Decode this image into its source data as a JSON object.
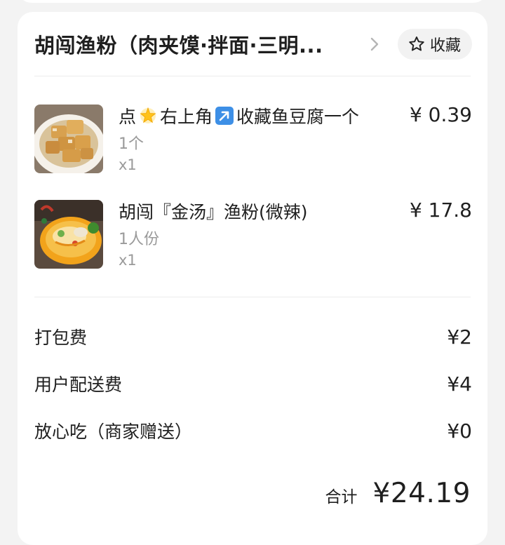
{
  "store": {
    "name": "胡闯渔粉（肉夹馍·拌面·三明...",
    "favorite_label": "收藏"
  },
  "items": [
    {
      "name_prefix": "点",
      "name_middle": "右上角",
      "name_suffix": "收藏鱼豆腐一个",
      "spec": "1个",
      "qty": "x1",
      "price": "¥ 0.39",
      "image_icon": "fish-tofu-image"
    },
    {
      "name": "胡闯『金汤』渔粉(微辣)",
      "spec": "1人份",
      "qty": "x1",
      "price": "¥ 17.8",
      "image_icon": "golden-soup-noodle-image"
    }
  ],
  "fees": [
    {
      "label": "打包费",
      "value": "¥2"
    },
    {
      "label": "用户配送费",
      "value": "¥4"
    },
    {
      "label": "放心吃（商家赠送）",
      "value": "¥0"
    }
  ],
  "total": {
    "label": "合计",
    "value": "¥24.19"
  },
  "colors": {
    "background": "#f3f3f3",
    "card": "#ffffff",
    "muted_text": "#9a9a9a",
    "button_bg": "#f2f2f2"
  }
}
